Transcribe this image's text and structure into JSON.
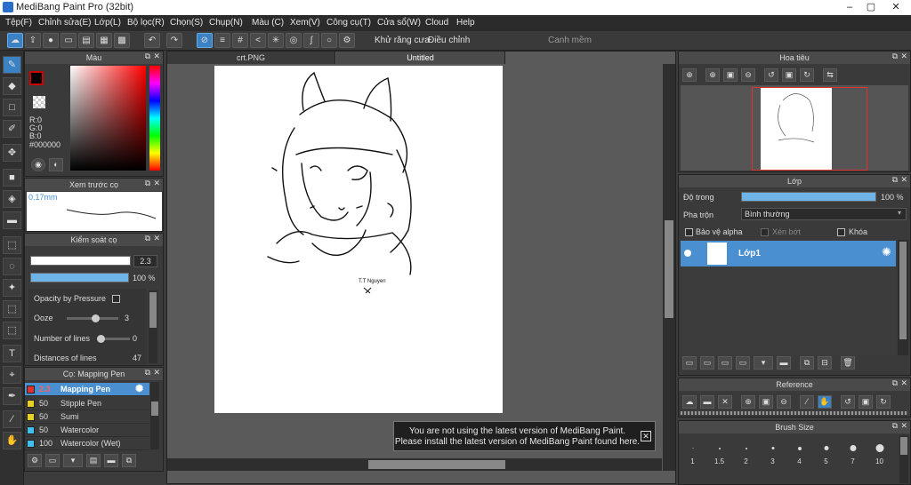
{
  "window": {
    "title": "MediBang Paint Pro (32bit)",
    "minimize": "–",
    "maximize": "▢",
    "close": "✕"
  },
  "menu": [
    "Tệp(F)",
    "Chỉnh sửa(E)",
    "Lớp(L)",
    "Bộ lọc(R)",
    "Chọn(S)",
    "Chụp(N)",
    "Màu (C)",
    "Xem(V)",
    "Công cụ(T)",
    "Cửa sổ(W)",
    "Cloud",
    "Help"
  ],
  "toolbar": {
    "antialias_label": "Khử răng cưa",
    "correction_label": "Điều chỉnh",
    "correction_value": "2",
    "snap_label": "Canh mềm"
  },
  "color_panel": {
    "title": "Màu",
    "r": "R:0",
    "g": "G:0",
    "b": "B:0",
    "hex": "#000000",
    "accent": "#cc0000"
  },
  "brush_preview": {
    "title": "Xem trước cọ",
    "size": "0.17mm"
  },
  "brush_control": {
    "title": "Kiểm soát cọ",
    "size_value": "2.3",
    "opacity_value": "100 %",
    "opacity_pressure_label": "Opacity by Pressure",
    "ooze_label": "Ooze",
    "ooze_value": "3",
    "lines_label": "Number of lines",
    "lines_value": "0",
    "distance_label": "Distances of lines",
    "distance_value": "47"
  },
  "brush_list": {
    "title": "Cọ: Mapping Pen",
    "items": [
      {
        "size": "2.3",
        "name": "Mapping Pen",
        "color": "#e03030"
      },
      {
        "size": "50",
        "name": "Stipple Pen",
        "color": "#e8d020"
      },
      {
        "size": "50",
        "name": "Sumi",
        "color": "#e8d020"
      },
      {
        "size": "50",
        "name": "Watercolor",
        "color": "#40c0f0"
      },
      {
        "size": "100",
        "name": "Watercolor (Wet)",
        "color": "#40c0f0"
      }
    ]
  },
  "canvas": {
    "tabs": [
      "crt.PNG",
      "Untitled"
    ],
    "signature": "T.T Nguyen",
    "notice_line1": "You are not using the latest version of MediBang Paint.",
    "notice_line2": "Please install the latest version of MediBang Paint found here.",
    "notice_close": "✕"
  },
  "navigator": {
    "title": "Hoa tiêu"
  },
  "layers": {
    "title": "Lớp",
    "opacity_label": "Độ trong",
    "opacity_value": "100 %",
    "blend_label": "Pha trộn",
    "blend_value": "Bình thường",
    "protect_alpha": "Bảo vệ alpha",
    "clipping": "Xén bớt",
    "lock": "Khóa",
    "layer_name": "Lớp1"
  },
  "reference": {
    "title": "Reference"
  },
  "brush_size": {
    "title": "Brush Size",
    "sizes": [
      "1",
      "1.5",
      "2",
      "3",
      "4",
      "5",
      "7",
      "10"
    ]
  }
}
